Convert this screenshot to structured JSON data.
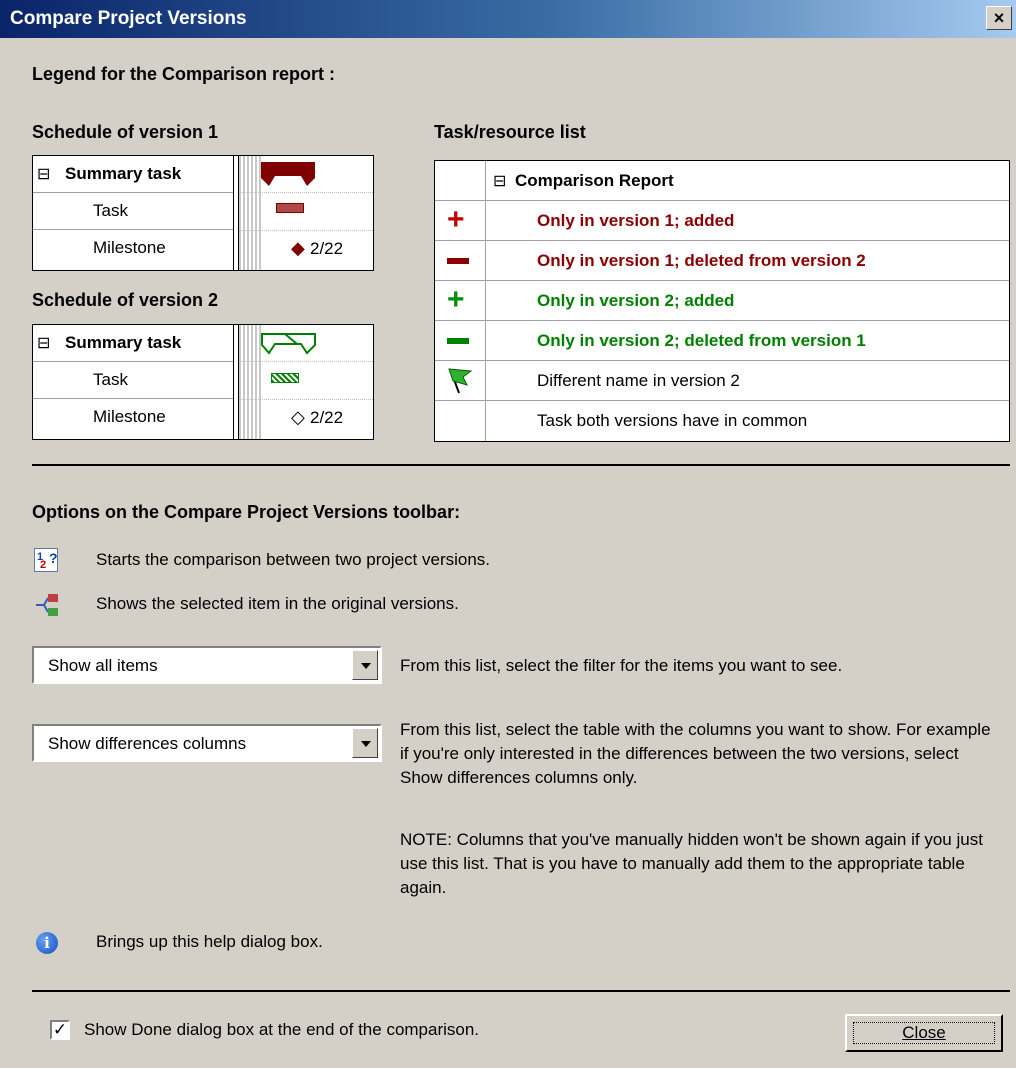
{
  "window": {
    "title": "Compare Project Versions",
    "close_glyph": "×"
  },
  "legend_heading": "Legend for the Comparison report :",
  "schedule1": {
    "heading": "Schedule of version 1",
    "summary": "Summary task",
    "task": "Task",
    "milestone": "Milestone",
    "milestone_date": "2/22"
  },
  "schedule2": {
    "heading": "Schedule of version 2",
    "summary": "Summary task",
    "task": "Task",
    "milestone": "Milestone",
    "milestone_date": "2/22"
  },
  "tasklist": {
    "heading": "Task/resource list",
    "report": "Comparison Report",
    "rows": [
      {
        "icon": "red-plus-icon",
        "text": "Only in version 1; added",
        "color": "#8b0000"
      },
      {
        "icon": "red-minus-icon",
        "text": "Only in version 1; deleted from version 2",
        "color": "#8b0000"
      },
      {
        "icon": "green-plus-icon",
        "text": "Only in version 2; added",
        "color": "#008000"
      },
      {
        "icon": "green-minus-icon",
        "text": "Only in version 2; deleted from version 1",
        "color": "#008000"
      },
      {
        "icon": "green-flag-icon",
        "text": "Different name in version 2"
      },
      {
        "icon": "",
        "text": "Task both versions have in common"
      }
    ]
  },
  "options": {
    "heading": "Options on the Compare Project Versions toolbar:",
    "compare_desc": "Starts the comparison between two project versions.",
    "goto_desc": "Shows the selected item in the original versions.",
    "filter_value": "Show all items",
    "filter_desc": "From this list, select the filter for the items you want to see.",
    "columns_value": "Show differences columns",
    "columns_desc": "From this list, select the table with the columns you want to show. For example if you're only interested in the differences between the two versions, select Show differences columns only.",
    "note": "NOTE: Columns that you've manually hidden won't be shown again if you just use this list. That is you have to manually add them to the appropriate table again.",
    "help_desc": "Brings up this help dialog box."
  },
  "footer": {
    "checkbox_label": "Show Done dialog box at the end of the comparison.",
    "checked": true,
    "close_label": "Close"
  }
}
